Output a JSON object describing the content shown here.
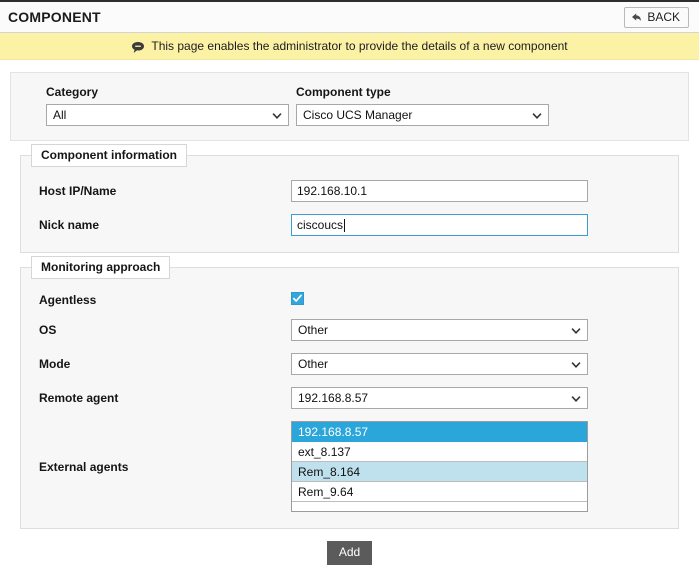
{
  "header": {
    "title": "COMPONENT",
    "back_label": "BACK",
    "back_icon": "back-arrow-icon"
  },
  "banner": {
    "icon": "comment-bubble-icon",
    "message": "This page enables the administrator to provide the details of a new component"
  },
  "selector_panel": {
    "category": {
      "label": "Category",
      "value": "All",
      "icon": "chevron-down-icon"
    },
    "component_type": {
      "label": "Component type",
      "value": "Cisco UCS Manager",
      "icon": "chevron-down-icon"
    }
  },
  "component_information": {
    "legend": "Component information",
    "host": {
      "label": "Host IP/Name",
      "value": "192.168.10.1"
    },
    "nick": {
      "label": "Nick name",
      "value": "ciscoucs"
    }
  },
  "monitoring_approach": {
    "legend": "Monitoring approach",
    "agentless": {
      "label": "Agentless",
      "checked": true,
      "icon": "checkmark-icon"
    },
    "os": {
      "label": "OS",
      "value": "Other",
      "icon": "chevron-down-icon"
    },
    "mode": {
      "label": "Mode",
      "value": "Other",
      "icon": "chevron-down-icon"
    },
    "remote_agent": {
      "label": "Remote agent",
      "value": "192.168.8.57",
      "icon": "chevron-down-icon"
    },
    "external_agents": {
      "label": "External agents",
      "options": [
        {
          "label": "192.168.8.57",
          "state": "selected"
        },
        {
          "label": "ext_8.137",
          "state": "normal"
        },
        {
          "label": "Rem_8.164",
          "state": "hovered"
        },
        {
          "label": "Rem_9.64",
          "state": "normal"
        }
      ]
    }
  },
  "footer": {
    "add_label": "Add"
  },
  "colors": {
    "accent_blue": "#2ba6db",
    "hover_blue": "#bfe0ed",
    "banner_yellow": "#fcf2a5",
    "panel_gray": "#f7f7f7",
    "button_gray": "#5b5b5b"
  }
}
